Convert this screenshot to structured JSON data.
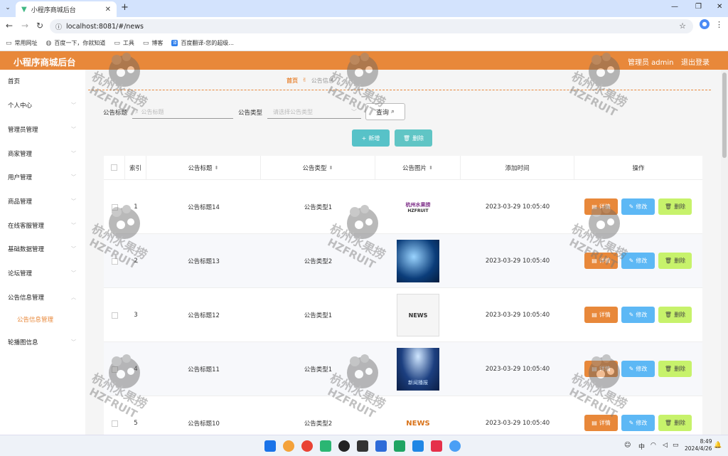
{
  "browser": {
    "tab_title": "小程序商城后台",
    "url": "localhost:8081/#/news",
    "bookmarks": [
      {
        "label": "常用网址"
      },
      {
        "label": "百度一下，你就知道"
      },
      {
        "label": "工具"
      },
      {
        "label": "博客"
      },
      {
        "label": "百度翻译-您的超级..."
      }
    ]
  },
  "header": {
    "title": "小程序商城后台",
    "user": "管理员 admin",
    "logout": "退出登录",
    "accent": "#e8883a"
  },
  "sidebar": {
    "items": [
      {
        "label": "首页"
      },
      {
        "label": "个人中心"
      },
      {
        "label": "管理员管理"
      },
      {
        "label": "商家管理"
      },
      {
        "label": "用户管理"
      },
      {
        "label": "商品管理"
      },
      {
        "label": "在线客服管理"
      },
      {
        "label": "基础数据管理"
      },
      {
        "label": "论坛管理"
      },
      {
        "label": "公告信息管理"
      },
      {
        "label": "公告信息管理"
      },
      {
        "label": "轮播图信息"
      }
    ]
  },
  "breadcrumb": {
    "home": "首页",
    "current": "公告信息"
  },
  "search": {
    "title_label": "公告标题",
    "title_placeholder": "公告标题",
    "type_label": "公告类型",
    "type_placeholder": "请选择公告类型",
    "query_button": "查询"
  },
  "toolbar": {
    "add_label": "新增",
    "delete_label": "删除"
  },
  "table": {
    "headers": {
      "index": "索引",
      "title": "公告标题",
      "type": "公告类型",
      "image": "公告图片",
      "time": "添加时间",
      "actions": "操作"
    },
    "rows": [
      {
        "index": "1",
        "title": "公告标题14",
        "type": "公告类型1",
        "time": "2023-03-29 10:05:40",
        "image_text": "杭州水果捞",
        "image_sub": "HZFRUIT"
      },
      {
        "index": "2",
        "title": "公告标题13",
        "type": "公告类型2",
        "time": "2023-03-29 10:05:40",
        "image_text": "",
        "image_sub": ""
      },
      {
        "index": "3",
        "title": "公告标题12",
        "type": "公告类型1",
        "time": "2023-03-29 10:05:40",
        "image_text": "NEWS",
        "image_sub": ""
      },
      {
        "index": "4",
        "title": "公告标题11",
        "type": "公告类型1",
        "time": "2023-03-29 10:05:40",
        "image_text": "新闻播报",
        "image_sub": ""
      },
      {
        "index": "5",
        "title": "公告标题10",
        "type": "公告类型2",
        "time": "2023-03-29 10:05:40",
        "image_text": "NEWS",
        "image_sub": ""
      }
    ],
    "actions": {
      "detail": "详情",
      "edit": "修改",
      "remove": "删除"
    }
  },
  "watermark": {
    "text": "杭州水果捞",
    "sub": "HZFRUIT"
  },
  "taskbar": {
    "lang": "中",
    "time": "8:49",
    "date": "2024/4/26"
  }
}
